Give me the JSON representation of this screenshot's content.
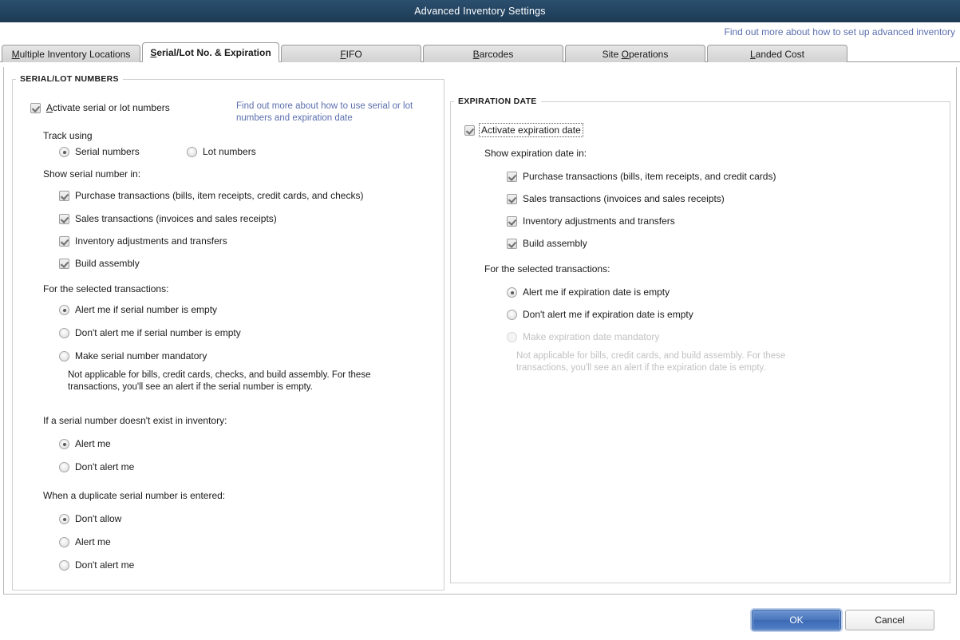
{
  "window": {
    "title": "Advanced Inventory Settings"
  },
  "header": {
    "help_link": "Find out more about how to set up advanced inventory"
  },
  "tabs": [
    {
      "label": "Multiple Inventory Locations",
      "accel": "M",
      "active": false,
      "width": 174,
      "name": "tab-multiple-inventory-locations"
    },
    {
      "label": "Serial/Lot No. & Expiration",
      "accel": "S",
      "active": true,
      "width": 172,
      "name": "tab-serial-lot-no-expiration"
    },
    {
      "label": "FIFO",
      "accel": "F",
      "active": false,
      "width": 176,
      "name": "tab-fifo"
    },
    {
      "label": "Barcodes",
      "accel": "B",
      "active": false,
      "width": 176,
      "name": "tab-barcodes"
    },
    {
      "label": "Site Operations",
      "accel": "O",
      "active": false,
      "width": 176,
      "name": "tab-site-operations"
    },
    {
      "label": "Landed Cost",
      "accel": "L",
      "active": false,
      "width": 176,
      "name": "tab-landed-cost"
    }
  ],
  "serial_section": {
    "legend": "SERIAL/LOT NUMBERS",
    "activate": {
      "label": "Activate serial or lot numbers",
      "accel": "A",
      "checked": true
    },
    "help_link": "Find out more about how to use serial or lot numbers and expiration date",
    "track_using_label": "Track using",
    "track_options": [
      {
        "label": "Serial numbers",
        "selected": true
      },
      {
        "label": "Lot numbers",
        "selected": false
      }
    ],
    "show_in_label": "Show serial number in:",
    "show_in_options": [
      {
        "label": "Purchase transactions (bills, item receipts, credit cards, and checks)",
        "checked": true
      },
      {
        "label": "Sales transactions (invoices and sales receipts)",
        "checked": true
      },
      {
        "label": "Inventory adjustments and transfers",
        "checked": true
      },
      {
        "label": "Build assembly",
        "checked": true
      }
    ],
    "selected_transactions_label": "For the selected transactions:",
    "selected_transactions_options": [
      {
        "label": "Alert me if serial number is empty",
        "selected": true,
        "disabled": false
      },
      {
        "label": "Don't alert me if serial number is empty",
        "selected": false,
        "disabled": false
      },
      {
        "label": "Make serial number mandatory",
        "selected": false,
        "disabled": false
      }
    ],
    "mandatory_note": "Not applicable for bills, credit cards, checks, and build assembly. For these transactions, you'll see an alert if the serial number is empty.",
    "not_exist_label": "If a serial number doesn't exist in inventory:",
    "not_exist_options": [
      {
        "label": "Alert me",
        "selected": true
      },
      {
        "label": "Don't alert me",
        "selected": false
      }
    ],
    "duplicate_label": "When a duplicate serial number is entered:",
    "duplicate_options": [
      {
        "label": "Don't allow",
        "selected": true
      },
      {
        "label": "Alert me",
        "selected": false
      },
      {
        "label": "Don't alert me",
        "selected": false
      }
    ]
  },
  "expiration_section": {
    "legend": "EXPIRATION DATE",
    "activate": {
      "label": "Activate expiration date",
      "checked": true,
      "focused": true
    },
    "show_in_label": "Show expiration date in:",
    "show_in_options": [
      {
        "label": "Purchase transactions (bills, item receipts, and credit cards)",
        "checked": true
      },
      {
        "label": "Sales transactions (invoices and sales receipts)",
        "checked": true
      },
      {
        "label": "Inventory adjustments and transfers",
        "checked": true
      },
      {
        "label": "Build assembly",
        "checked": true
      }
    ],
    "selected_transactions_label": "For the selected transactions:",
    "selected_transactions_options": [
      {
        "label": "Alert me if expiration date is empty",
        "selected": true,
        "disabled": false
      },
      {
        "label": "Don't alert me if expiration date is empty",
        "selected": false,
        "disabled": false
      },
      {
        "label": "Make expiration date mandatory",
        "selected": false,
        "disabled": true
      }
    ],
    "mandatory_note": "Not applicable for bills, credit cards, and build assembly. For these transactions, you'll see an alert if the expiration date is empty."
  },
  "footer": {
    "ok_label": "OK",
    "cancel_label": "Cancel"
  },
  "colors": {
    "titlebar": "#234461",
    "link": "#5b6fae",
    "ok_button": "#4a76bd",
    "disabled_text": "#c2c2c2"
  }
}
